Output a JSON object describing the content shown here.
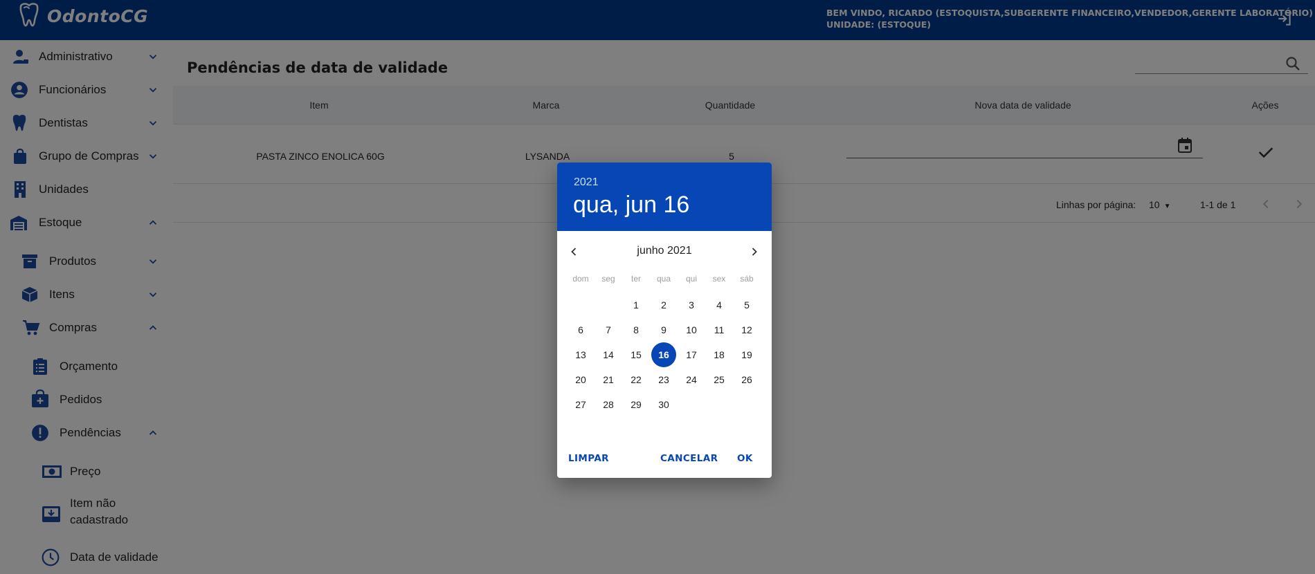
{
  "header": {
    "app_name": "OdontoCG",
    "user_line": "BEM VINDO, RICARDO (ESTOQUISTA,SUBGERENTE FINANCEIRO,VENDEDOR,GERENTE LABORATÓRIO)",
    "unit_line": "UNIDADE: (ESTOQUE)"
  },
  "sidebar": {
    "items": [
      {
        "label": "Administrativo",
        "icon": "admin-user-icon"
      },
      {
        "label": "Funcionários",
        "icon": "person-circle-icon"
      },
      {
        "label": "Dentistas",
        "icon": "tooth-icon"
      },
      {
        "label": "Grupo de Compras",
        "icon": "shopping-bag-icon"
      },
      {
        "label": "Unidades",
        "icon": "building-icon"
      },
      {
        "label": "Estoque",
        "icon": "warehouse-icon"
      },
      {
        "label": "Produtos",
        "icon": "archive-box-icon"
      },
      {
        "label": "Itens",
        "icon": "cube-icon"
      },
      {
        "label": "Compras",
        "icon": "cart-icon"
      },
      {
        "label": "Orçamento",
        "icon": "clipboard-list-icon"
      },
      {
        "label": "Pedidos",
        "icon": "bag-plus-icon"
      },
      {
        "label": "Pendências",
        "icon": "alert-circle-icon"
      },
      {
        "label": "Preço",
        "icon": "money-icon"
      },
      {
        "label": "Item não cadastrado",
        "icon": "tray-download-icon"
      },
      {
        "label": "Data de validade",
        "icon": "clock-icon"
      }
    ]
  },
  "main": {
    "title": "Pendências de data de validade",
    "columns": [
      "Item",
      "Marca",
      "Quantidade",
      "Nova data de validade",
      "Ações"
    ],
    "rows": [
      {
        "item": "PASTA ZINCO ENOLICA 60G",
        "marca": "LYSANDA",
        "quantidade": "5",
        "nova_data": ""
      }
    ],
    "pagination": {
      "rows_per_page_label": "Linhas por página:",
      "rows_per_page": "10",
      "range": "1-1 de 1"
    }
  },
  "datepicker": {
    "year": "2021",
    "selected_label": "qua, jun 16",
    "month_label": "junho 2021",
    "weekdays": [
      "dom",
      "seg",
      "ter",
      "qua",
      "qui",
      "sex",
      "sáb"
    ],
    "first_weekday_index": 2,
    "days_in_month": 30,
    "selected_day": 16,
    "buttons": {
      "clear": "LIMPAR",
      "cancel": "CANCELAR",
      "ok": "OK"
    }
  },
  "colors": {
    "primary": "#003b8e",
    "accent": "#0747b5",
    "icon_blue": "#1d4aa0"
  }
}
